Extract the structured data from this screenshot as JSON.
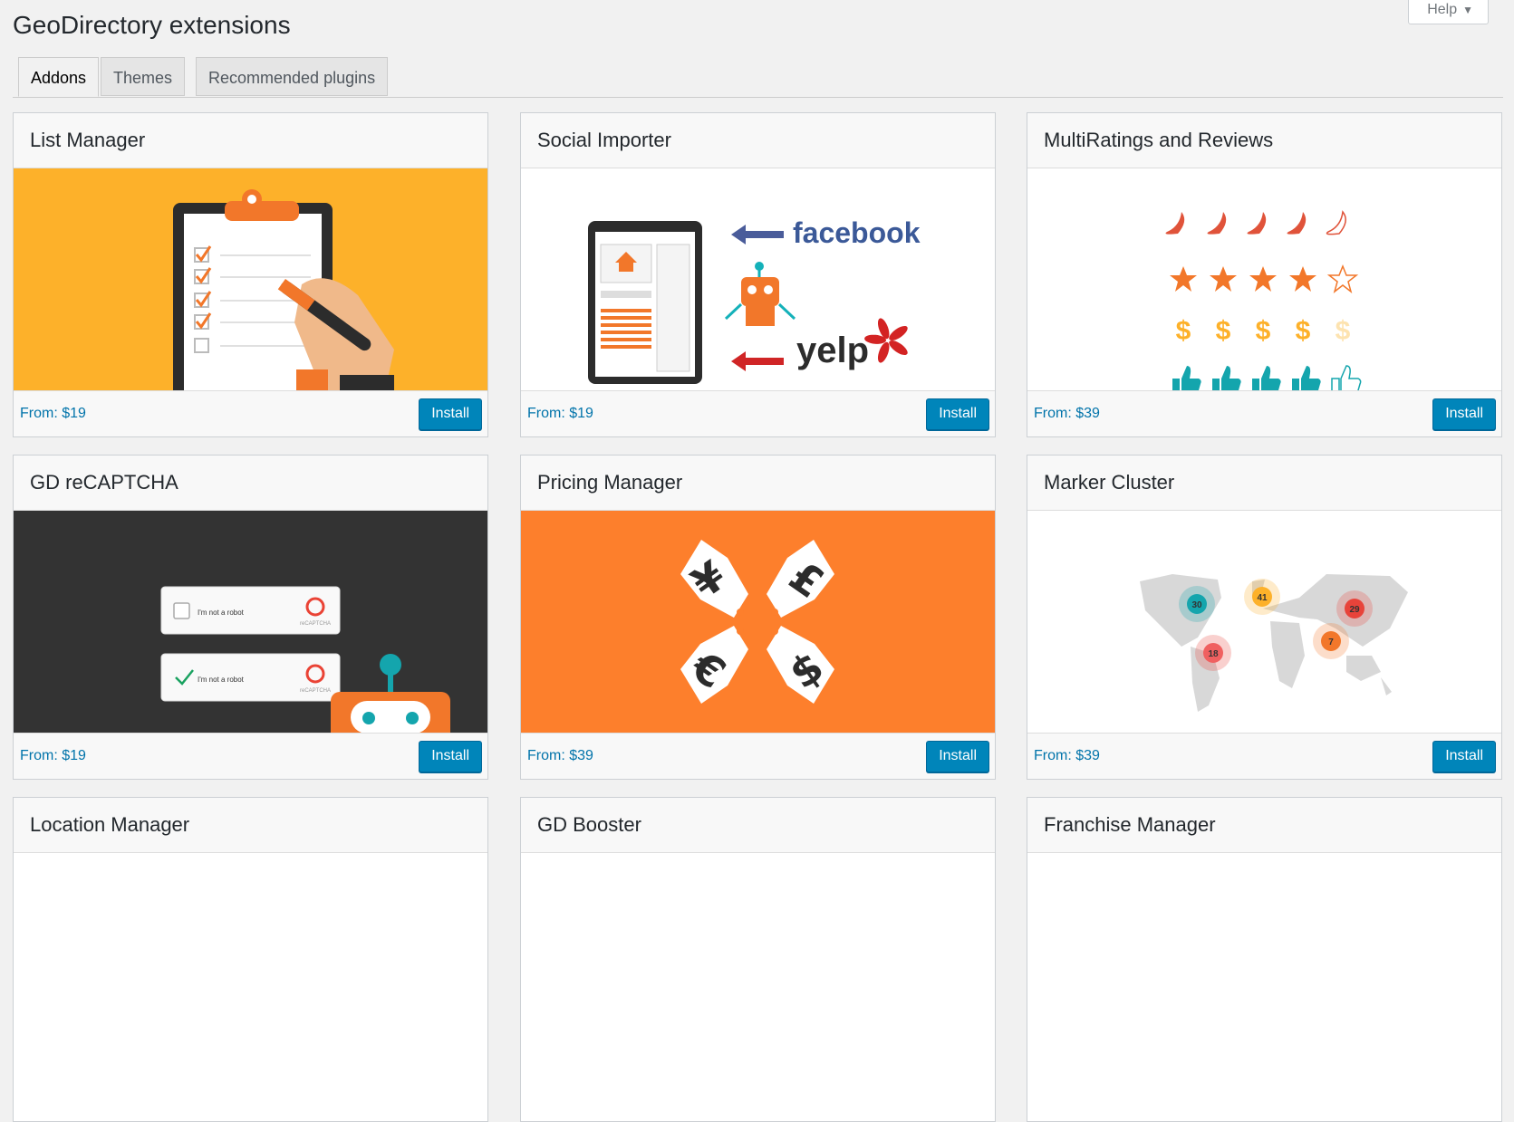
{
  "help": {
    "label": "Help"
  },
  "page": {
    "title": "GeoDirectory extensions"
  },
  "tabs": [
    {
      "label": "Addons",
      "active": true
    },
    {
      "label": "Themes",
      "active": false
    },
    {
      "label": "Recommended plugins",
      "active": false
    }
  ],
  "cards": [
    {
      "title": "List Manager",
      "price": "From: $19",
      "button": "Install"
    },
    {
      "title": "Social Importer",
      "price": "From: $19",
      "button": "Install",
      "image_text": {
        "facebook": "facebook",
        "yelp": "yelp"
      }
    },
    {
      "title": "MultiRatings and Reviews",
      "price": "From: $39",
      "button": "Install",
      "image_text": {
        "dollar": "$"
      }
    },
    {
      "title": "GD reCAPTCHA",
      "price": "From: $19",
      "button": "Install",
      "image_text": {
        "robot_label": "I'm not a robot",
        "brand": "reCAPTCHA"
      }
    },
    {
      "title": "Pricing Manager",
      "price": "From: $39",
      "button": "Install",
      "image_text": {
        "yen": "¥",
        "pound": "£",
        "euro": "€",
        "dollar": "$"
      }
    },
    {
      "title": "Marker Cluster",
      "price": "From: $39",
      "button": "Install",
      "image_text": {
        "c1": "30",
        "c2": "41",
        "c3": "29",
        "c4": "18",
        "c5": "7"
      }
    },
    {
      "title": "Location Manager"
    },
    {
      "title": "GD Booster"
    },
    {
      "title": "Franchise Manager"
    }
  ],
  "colors": {
    "accent": "#0085ba",
    "orange": "#fd7f2c",
    "yellow": "#fdb12a",
    "dark": "#333333"
  }
}
